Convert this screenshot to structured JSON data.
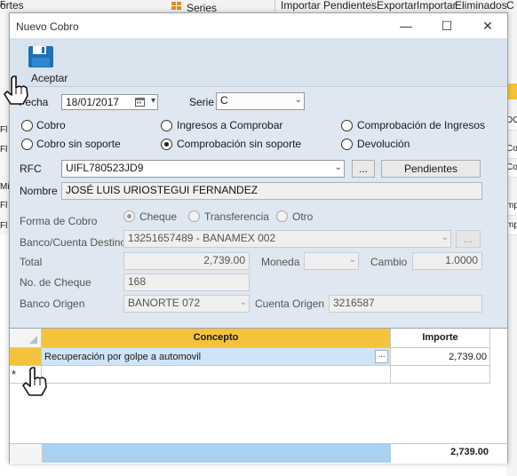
{
  "background": {
    "menu_items": [
      "ortes",
      "Series",
      "Importar Pendientes",
      "Exportar",
      "Importar",
      "Eliminados",
      "C"
    ],
    "right_cells": [
      "DO",
      "Cor",
      "Cor",
      "mp",
      "mp"
    ],
    "left_cells": [
      "F",
      "Fl",
      "Fl",
      "Mi",
      "Fl",
      "Fl"
    ]
  },
  "dialog": {
    "title": "Nuevo Cobro",
    "minimize": "—",
    "maximize": "☐",
    "close": "✕",
    "toolbar": {
      "accept_label": "Aceptar"
    },
    "fecha": {
      "label": "Fecha",
      "value": "18/01/2017"
    },
    "serie": {
      "label": "Serie",
      "value": "C"
    },
    "tipo": {
      "options": [
        {
          "label": "Cobro",
          "checked": false
        },
        {
          "label": "Ingresos a Comprobar",
          "checked": false
        },
        {
          "label": "Comprobación de Ingresos",
          "checked": false
        },
        {
          "label": "Cobro sin soporte",
          "checked": false
        },
        {
          "label": "Comprobación sin soporte",
          "checked": true
        },
        {
          "label": "Devolución",
          "checked": false
        }
      ]
    },
    "rfc": {
      "label": "RFC",
      "value": "UIFL780523JD9",
      "ellipsis": "...",
      "pendientes": "Pendientes"
    },
    "nombre": {
      "label": "Nombre",
      "value": "JOSÉ LUIS URIOSTEGUI FERNANDEZ"
    },
    "forma": {
      "label": "Forma de Cobro",
      "options": [
        {
          "label": "Cheque",
          "checked": true
        },
        {
          "label": "Transferencia",
          "checked": false
        },
        {
          "label": "Otro",
          "checked": false
        }
      ]
    },
    "banco_destino": {
      "label": "Banco/Cuenta Destino",
      "value": "13251657489 - BANAMEX  002",
      "ellipsis": "..."
    },
    "total": {
      "label": "Total",
      "value": "2,739.00"
    },
    "moneda": {
      "label": "Moneda",
      "value": ""
    },
    "cambio": {
      "label": "Cambio",
      "value": "1.0000"
    },
    "cheque": {
      "label": "No. de Cheque",
      "value": "168"
    },
    "banco_origen": {
      "label": "Banco Origen",
      "value": "BANORTE  072"
    },
    "cuenta_origen": {
      "label": "Cuenta Origen",
      "value": "3216587"
    },
    "grid": {
      "columns": [
        "Concepto",
        "Importe"
      ],
      "rows": [
        {
          "concepto": "Recuperación por golpe a automovil",
          "importe": "2,739.00",
          "ellipsis": "..."
        }
      ],
      "new_row_marker": "*",
      "total": "2,739.00"
    }
  },
  "colors": {
    "dialog_bg": "#dfe7f0",
    "header_highlight": "#f5c33b",
    "selection": "#cfe4f7",
    "total_bar": "#a8d1f2"
  },
  "icons": [
    "save-icon",
    "hand-pointer-icon",
    "calendar-icon",
    "dropdown-arrow-icon",
    "triangle-row-indicator-icon"
  ]
}
